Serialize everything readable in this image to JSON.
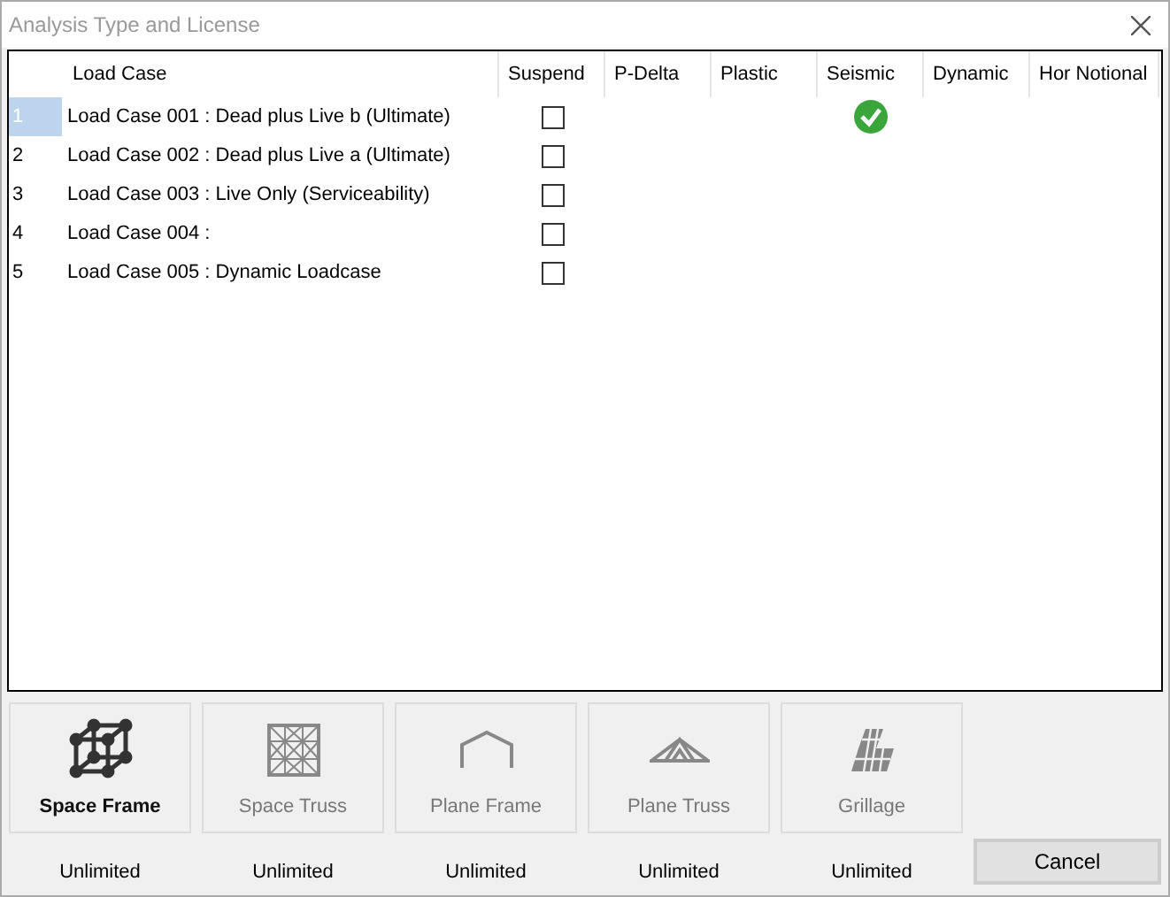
{
  "window": {
    "title": "Analysis Type and License"
  },
  "table": {
    "columns": [
      "Load Case",
      "Suspend",
      "P-Delta",
      "Plastic",
      "Seismic",
      "Dynamic",
      "Hor Notional"
    ],
    "rows": [
      {
        "number": "1",
        "name": "Load Case 001 : Dead plus Live b (Ultimate)",
        "selected": true,
        "suspend": false,
        "seismic": true
      },
      {
        "number": "2",
        "name": "Load Case 002 : Dead plus Live a (Ultimate)",
        "selected": false,
        "suspend": false,
        "seismic": false
      },
      {
        "number": "3",
        "name": "Load Case 003 : Live Only (Serviceability)",
        "selected": false,
        "suspend": false,
        "seismic": false
      },
      {
        "number": "4",
        "name": "Load Case 004 :",
        "selected": false,
        "suspend": false,
        "seismic": false
      },
      {
        "number": "5",
        "name": "Load Case 005 : Dynamic Loadcase",
        "selected": false,
        "suspend": false,
        "seismic": false
      }
    ]
  },
  "analysis_types": [
    {
      "kind": "space_frame",
      "label": "Space Frame",
      "selected": true,
      "license": "Unlimited"
    },
    {
      "kind": "space_truss",
      "label": "Space Truss",
      "selected": false,
      "license": "Unlimited"
    },
    {
      "kind": "plane_frame",
      "label": "Plane Frame",
      "selected": false,
      "license": "Unlimited"
    },
    {
      "kind": "plane_truss",
      "label": "Plane Truss",
      "selected": false,
      "license": "Unlimited"
    },
    {
      "kind": "grillage",
      "label": "Grillage",
      "selected": false,
      "license": "Unlimited"
    }
  ],
  "buttons": [
    "Cancel"
  ]
}
